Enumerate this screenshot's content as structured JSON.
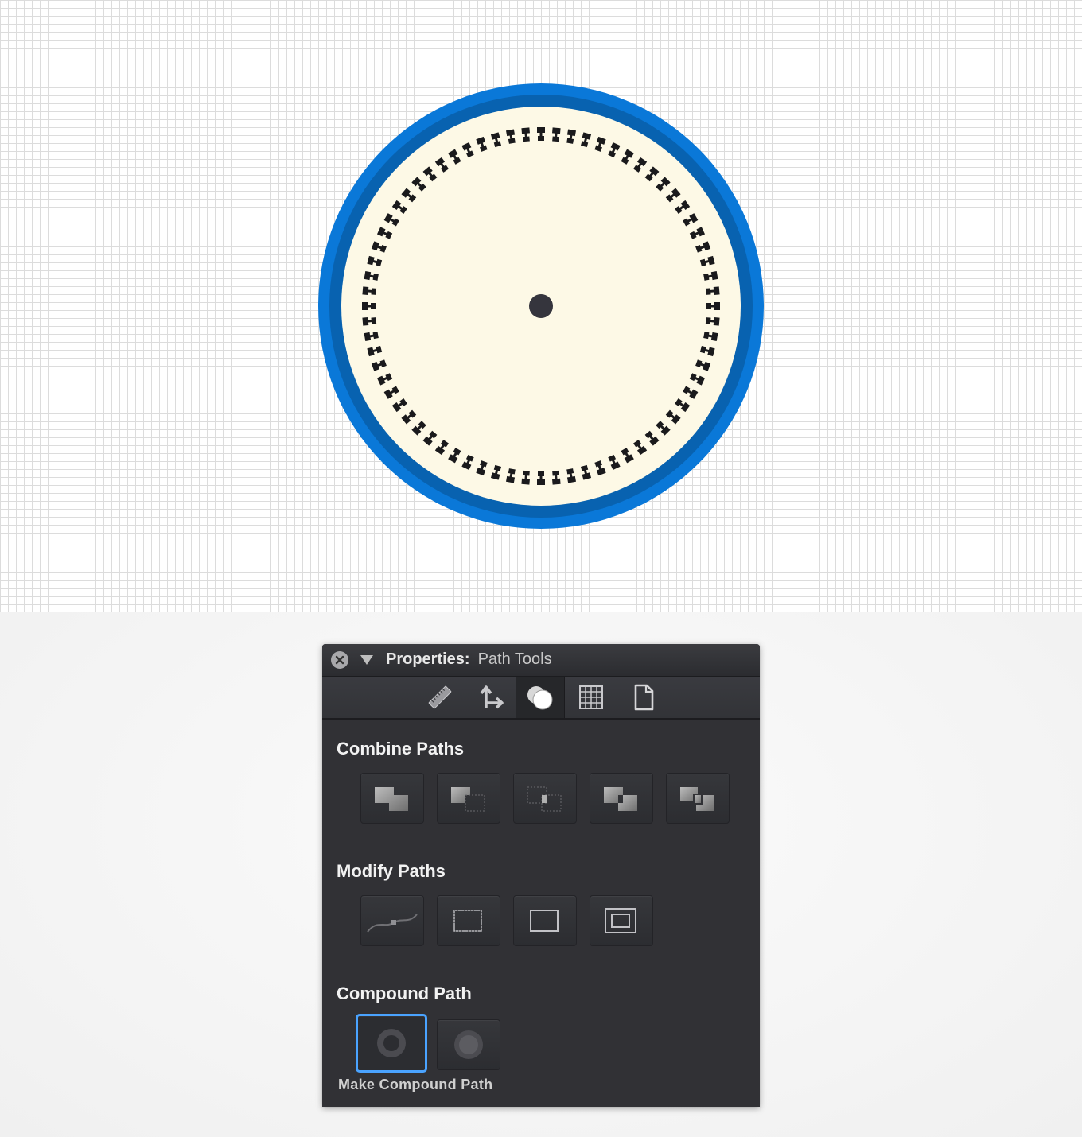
{
  "panel": {
    "title_bold": "Properties:",
    "title_regular": "Path Tools",
    "tabs": [
      {
        "icon": "ruler-icon"
      },
      {
        "icon": "transform-arrows-icon"
      },
      {
        "icon": "path-tools-icon",
        "active": true
      },
      {
        "icon": "grid-icon"
      },
      {
        "icon": "document-icon"
      }
    ],
    "sections": {
      "combine": {
        "title": "Combine Paths",
        "buttons": [
          "unite-icon",
          "minus-front-icon",
          "intersect-icon",
          "exclude-icon",
          "divide-icon"
        ]
      },
      "modify": {
        "title": "Modify Paths",
        "buttons": [
          "smooth-path-icon",
          "outline-dashed-icon",
          "outline-stroke-icon",
          "offset-path-icon"
        ]
      },
      "compound": {
        "title": "Compound Path",
        "buttons": [
          "make-compound-path-icon",
          "release-compound-path-icon"
        ],
        "tooltip": "Make Compound Path"
      }
    }
  },
  "colors": {
    "ring_outer": "#0a78d8",
    "ring_inner": "#0862b0",
    "face": "#fdf9e6",
    "ticks": "#1a1a1c",
    "center_dot": "#35353d",
    "selection": "#4aa3ff"
  },
  "dial": {
    "tick_count": 72
  }
}
